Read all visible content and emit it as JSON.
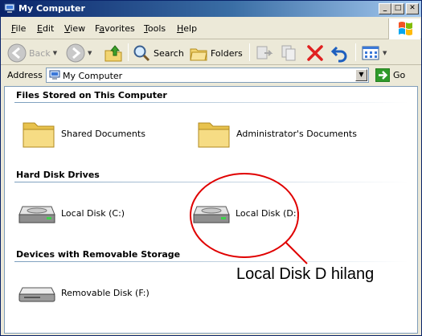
{
  "window": {
    "title": "My Computer"
  },
  "caption_buttons": {
    "minimize": "_",
    "maximize": "□",
    "close": "✕"
  },
  "menu": [
    {
      "label": "File",
      "key": "F",
      "rest": "ile"
    },
    {
      "label": "Edit",
      "key": "E",
      "rest": "dit"
    },
    {
      "label": "View",
      "key": "V",
      "rest": "iew"
    },
    {
      "label": "Favorites",
      "key": "a",
      "pre": "F",
      "rest": "vorites"
    },
    {
      "label": "Tools",
      "key": "T",
      "rest": "ools"
    },
    {
      "label": "Help",
      "key": "H",
      "rest": "elp"
    }
  ],
  "toolbar": {
    "back": "Back",
    "search": "Search",
    "folders": "Folders"
  },
  "address": {
    "label": "Address",
    "value": "My Computer",
    "go": "Go"
  },
  "groups": {
    "files": {
      "title": "Files Stored on This Computer",
      "items": [
        "Shared Documents",
        "Administrator's Documents"
      ]
    },
    "hdd": {
      "title": "Hard Disk Drives",
      "items": [
        "Local Disk (C:)",
        "Local Disk (D:)"
      ]
    },
    "removable": {
      "title": "Devices with Removable Storage",
      "items": [
        "Removable Disk (F:)"
      ]
    }
  },
  "annotation": {
    "text": "Local Disk D hilang",
    "color": "#e00000"
  },
  "colors": {
    "title_start": "#0a246a",
    "title_end": "#a6caf0",
    "chrome": "#ece9d8",
    "group_line": "#7b9ebd"
  }
}
